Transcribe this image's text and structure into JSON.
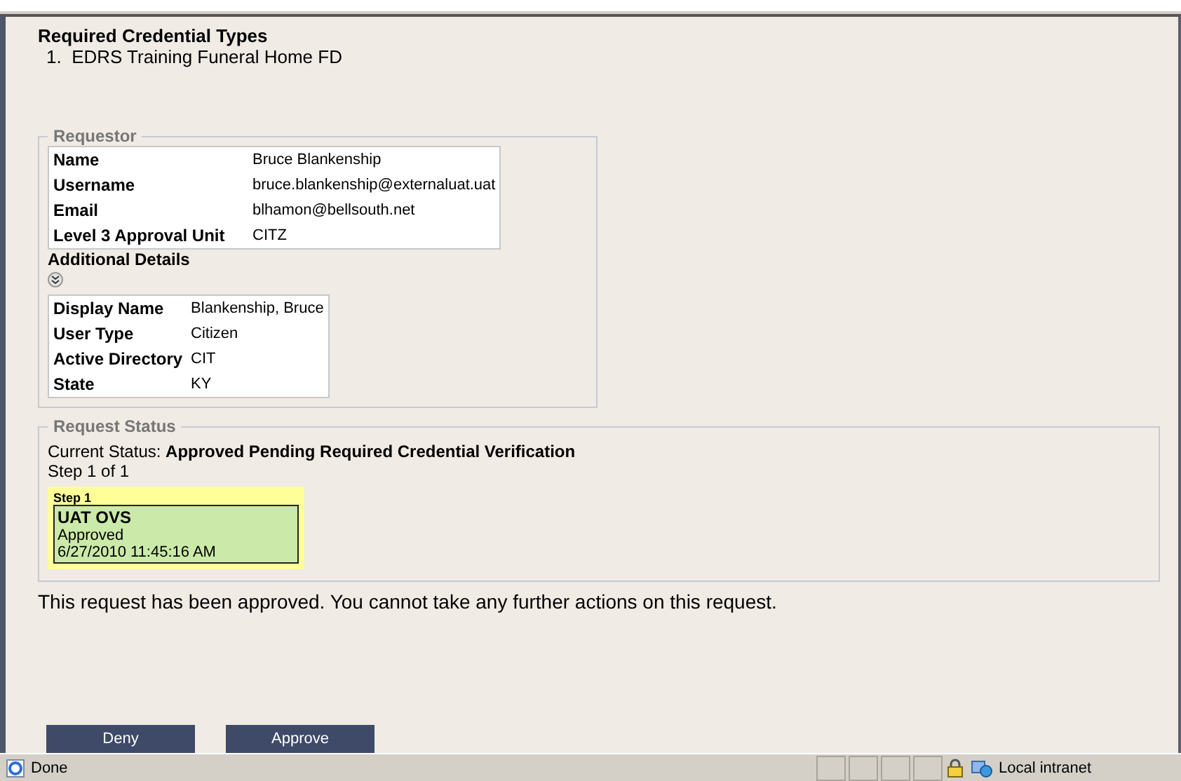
{
  "credentials": {
    "title": "Required Credential Types",
    "items": [
      "1.  EDRS Training Funeral Home FD"
    ]
  },
  "requestor": {
    "legend": "Requestor",
    "rows": [
      {
        "label": "Name",
        "value": "Bruce Blankenship"
      },
      {
        "label": "Username",
        "value": "bruce.blankenship@externaluat.uat"
      },
      {
        "label": "Email",
        "value": "blhamon@bellsouth.net"
      },
      {
        "label": "Level 3 Approval Unit",
        "value": "CITZ"
      }
    ]
  },
  "additional": {
    "title": "Additional Details",
    "expanded": true,
    "rows": [
      {
        "label": "Display Name",
        "value": "Blankenship, Bruce"
      },
      {
        "label": "User Type",
        "value": "Citizen"
      },
      {
        "label": "Active Directory",
        "value": "CIT"
      },
      {
        "label": "State",
        "value": "KY"
      }
    ]
  },
  "request_status": {
    "legend": "Request Status",
    "current_label": "Current Status: ",
    "current_value": "Approved Pending Required Credential Verification",
    "step_text": "Step 1 of 1",
    "steps": [
      {
        "label": "Step 1",
        "name": "UAT OVS",
        "status": "Approved",
        "time": "6/27/2010 11:45:16 AM",
        "color": "#cbe9a8"
      }
    ]
  },
  "message": "This request has been approved. You cannot take any further actions on this request.",
  "buttons": [
    "Deny",
    "Approve"
  ],
  "status_bar": {
    "text": "Done",
    "zone": "Local intranet"
  }
}
